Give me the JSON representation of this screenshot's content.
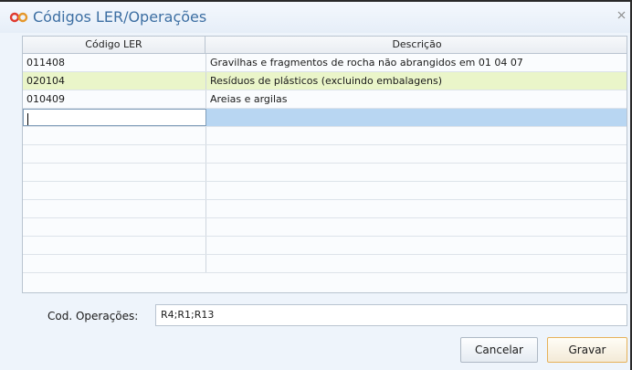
{
  "window": {
    "title": "Códigos LER/Operações"
  },
  "grid": {
    "columns": [
      "Código LER",
      "Descrição"
    ],
    "rows": [
      {
        "code": "011408",
        "description": "Gravilhas e fragmentos de rocha não abrangidos em 01 04 07"
      },
      {
        "code": "020104",
        "description": "Resíduos de plásticos (excluindo embalagens)"
      },
      {
        "code": "010409",
        "description": "Areias e argilas"
      },
      {
        "code": "",
        "description": ""
      }
    ],
    "selected_row": 1,
    "editing_row": 3,
    "empty_rows": 8
  },
  "operations": {
    "label": "Cod. Operações:",
    "value": "R4;R1;R13"
  },
  "buttons": {
    "cancel": "Cancelar",
    "save": "Gravar"
  },
  "colors": {
    "title": "#3d6fa3",
    "selected_row": "#eaf5c9",
    "editing_cell": "#b8d6f2",
    "save_border": "#e6b25a"
  },
  "icons": {
    "app": "infinity-logo-icon",
    "close": "close-icon"
  }
}
